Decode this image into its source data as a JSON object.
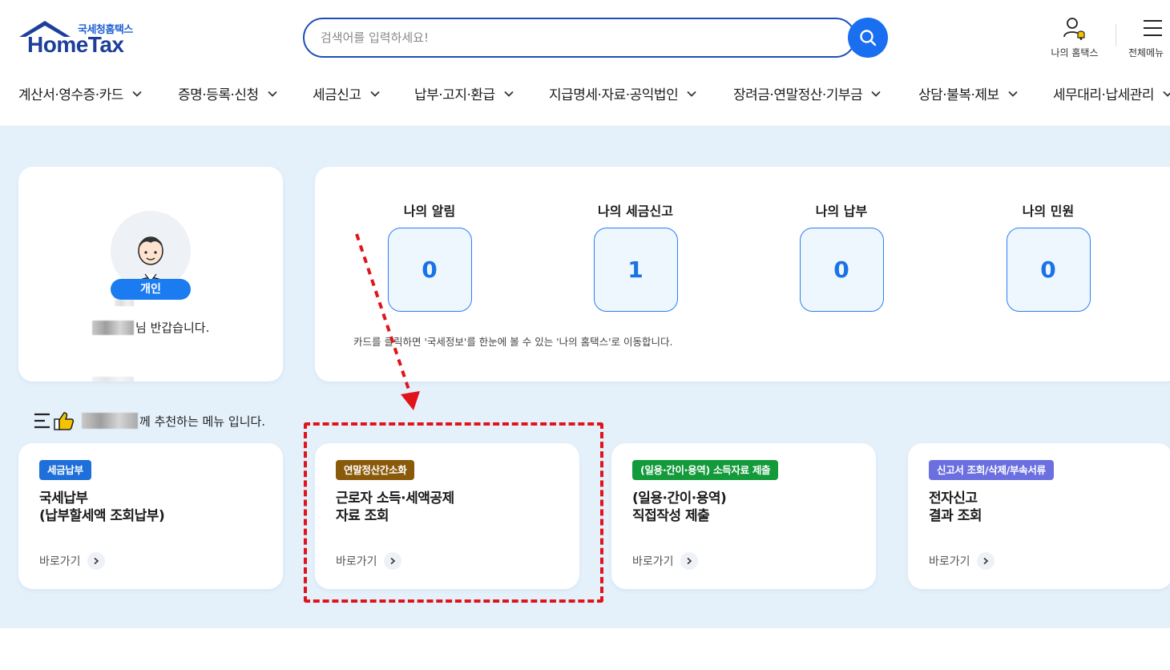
{
  "logo": {
    "sub": "국세청홈택스",
    "main": "HomeTax"
  },
  "search": {
    "placeholder": "검색어를 입력하세요!"
  },
  "top_util": {
    "my_hometax": "나의 홈택스",
    "all_menu": "전체메뉴"
  },
  "gnb": [
    "계산서·영수증·카드",
    "증명·등록·신청",
    "세금신고",
    "납부·고지·환급",
    "지급명세·자료·공익법인",
    "장려금·연말정산·기부금",
    "상담·불복·제보",
    "세무대리·납세관리"
  ],
  "profile": {
    "badge": "개인",
    "greeting": "님 반갑습니다."
  },
  "stats": [
    {
      "label": "나의 알림",
      "value": "0"
    },
    {
      "label": "나의 세금신고",
      "value": "1"
    },
    {
      "label": "나의 납부",
      "value": "0"
    },
    {
      "label": "나의 민원",
      "value": "0"
    }
  ],
  "stats_note": "카드를 클릭하면 '국세정보'를 한눈에 볼 수 있는 '나의 홈택스'로 이동합니다.",
  "recommend": {
    "text": "께 추천하는 메뉴 입니다."
  },
  "menu_cards": [
    {
      "tag": "세금납부",
      "tag_color": "#1e6fd9",
      "title": "국세납부\n(납부할세액 조회납부)",
      "go": "바로가기"
    },
    {
      "tag": "연말정산간소화",
      "tag_color": "#8a5a0b",
      "title": "근로자 소득·세액공제\n자료 조회",
      "go": "바로가기"
    },
    {
      "tag": "(일용·간이·용역) 소득자료 제출",
      "tag_color": "#139a3a",
      "title": "(일용·간이·용역)\n직접작성 제출",
      "go": "바로가기"
    },
    {
      "tag": "신고서 조회/삭제/부속서류",
      "tag_color": "#6b6fe0",
      "title": "전자신고\n결과 조회",
      "go": "바로가기"
    }
  ],
  "colors": {
    "brand_blue": "#1a6ef0",
    "page_bg": "#e4f1fb",
    "annotation_red": "#e0141a"
  }
}
